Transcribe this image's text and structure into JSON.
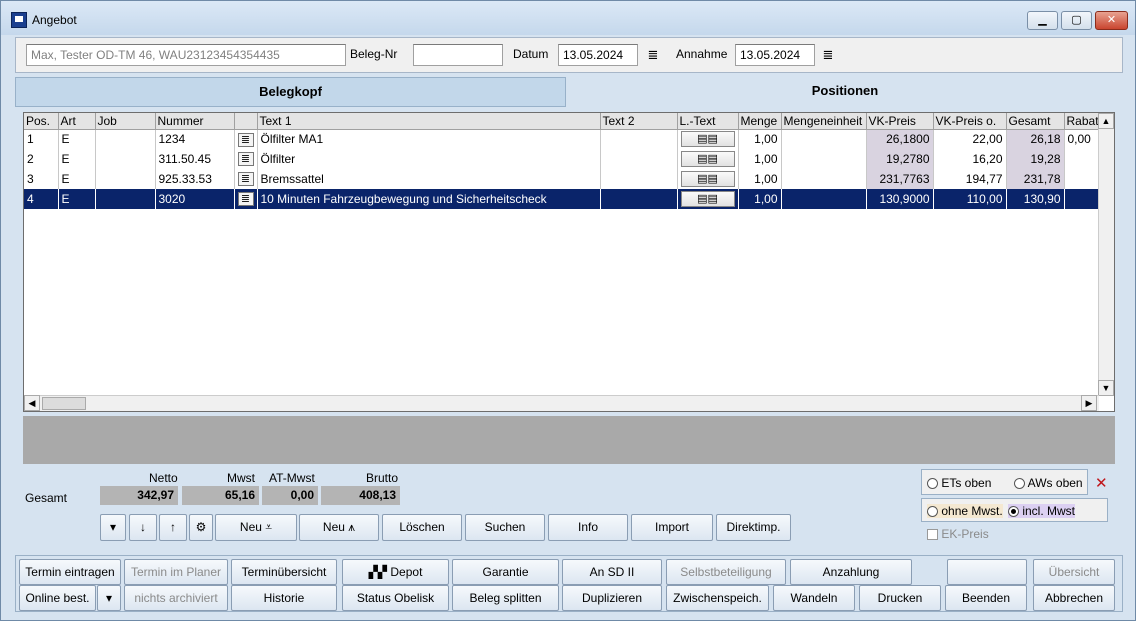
{
  "window": {
    "title": "Angebot"
  },
  "header": {
    "customer": "Max, Tester OD-TM 46, WAU23123454354435",
    "beleg_label": "Beleg-Nr",
    "beleg_value": "",
    "datum_label": "Datum",
    "datum_value": "13.05.2024",
    "annahme_label": "Annahme",
    "annahme_value": "13.05.2024"
  },
  "tabs": [
    {
      "label": "Belegkopf",
      "active": false
    },
    {
      "label": "Positionen",
      "active": true
    }
  ],
  "grid": {
    "columns": [
      "Pos.",
      "Art",
      "Job",
      "Nummer",
      "",
      "Text 1",
      "Text 2",
      "L.-Text",
      "Menge",
      "Mengeneinheit",
      "VK-Preis",
      "VK-Preis o.",
      "Gesamt",
      "Rabatt"
    ],
    "rows": [
      {
        "pos": "1",
        "art": "E",
        "job": "",
        "nummer": "1234",
        "text1": "Ölfilter MA1",
        "text2": "",
        "menge": "1,00",
        "einheit": "",
        "vk": "26,1800",
        "vko": "22,00",
        "gesamt": "26,18",
        "rabatt": "0,00"
      },
      {
        "pos": "2",
        "art": "E",
        "job": "",
        "nummer": "311.50.45",
        "text1": "Ölfilter",
        "text2": "",
        "menge": "1,00",
        "einheit": "",
        "vk": "19,2780",
        "vko": "16,20",
        "gesamt": "19,28",
        "rabatt": ""
      },
      {
        "pos": "3",
        "art": "E",
        "job": "",
        "nummer": "925.33.53",
        "text1": "Bremssattel",
        "text2": "",
        "menge": "1,00",
        "einheit": "",
        "vk": "231,7763",
        "vko": "194,77",
        "gesamt": "231,78",
        "rabatt": ""
      },
      {
        "pos": "4",
        "art": "E",
        "job": "",
        "nummer": "3020",
        "text1": "10 Minuten Fahrzeugbewegung und Sicherheitscheck",
        "text2": "",
        "menge": "1,00",
        "einheit": "",
        "vk": "130,9000",
        "vko": "110,00",
        "gesamt": "130,90",
        "rabatt": ""
      }
    ],
    "selected_row": 3
  },
  "totals": {
    "label": "Gesamt",
    "netto_label": "Netto",
    "netto": "342,97",
    "mwst_label": "Mwst",
    "mwst": "65,16",
    "atmwst_label": "AT-Mwst",
    "atmwst": "0,00",
    "brutto_label": "Brutto",
    "brutto": "408,13"
  },
  "action_buttons": {
    "neu1": "Neu",
    "neu2": "Neu",
    "loeschen": "Löschen",
    "suchen": "Suchen",
    "info": "Info",
    "import": "Import",
    "direktimp": "Direktimp."
  },
  "options": {
    "ets_oben": "ETs oben",
    "aws_oben": "AWs oben",
    "ohne_mwst": "ohne Mwst.",
    "incl_mwst": "incl. Mwst",
    "ek_preis": "EK-Preis"
  },
  "bottom_row1": {
    "termin_eintragen": "Termin eintragen",
    "termin_planer": "Termin im Planer",
    "terminuebersicht": "Terminübersicht",
    "depot": "Depot",
    "garantie": "Garantie",
    "an_sd": "An SD II",
    "selbstbeteiligung": "Selbstbeteiligung",
    "anzahlung": "Anzahlung",
    "uebersicht": "Übersicht"
  },
  "bottom_row2": {
    "online_best": "Online best.",
    "nichts_archiviert": "nichts archiviert",
    "historie": "Historie",
    "status_obelisk": "Status Obelisk",
    "beleg_splitten": "Beleg splitten",
    "duplizieren": "Duplizieren",
    "zwischenspeich": "Zwischenspeich.",
    "wandeln": "Wandeln",
    "drucken": "Drucken",
    "beenden": "Beenden",
    "abbrechen": "Abbrechen"
  },
  "icons": {
    "calendar": "calendar-list-icon",
    "close": "close-x-icon"
  }
}
